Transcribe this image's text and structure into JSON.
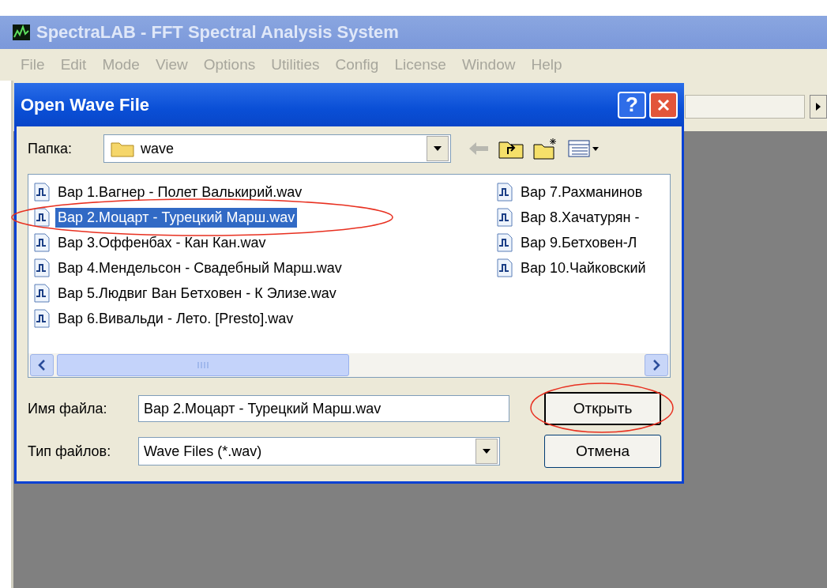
{
  "app": {
    "title": "SpectraLAB - FFT Spectral Analysis System",
    "menu": [
      {
        "label": "File",
        "disabled": true
      },
      {
        "label": "Edit",
        "disabled": true
      },
      {
        "label": "Mode",
        "disabled": true
      },
      {
        "label": "View",
        "disabled": true
      },
      {
        "label": "Options",
        "disabled": true
      },
      {
        "label": "Utilities",
        "disabled": true
      },
      {
        "label": "Config",
        "disabled": true
      },
      {
        "label": "License",
        "disabled": true
      },
      {
        "label": "Window",
        "disabled": true
      },
      {
        "label": "Help",
        "disabled": true
      }
    ]
  },
  "dialog": {
    "title": "Open Wave File",
    "help_button": "?",
    "folder": {
      "label": "Папка:",
      "value": "wave"
    },
    "files": [
      {
        "name": "Вар 1.Вагнер - Полет Валькирий.wav",
        "selected": false,
        "circled": false
      },
      {
        "name": "Вар 2.Моцарт - Турецкий Марш.wav",
        "selected": true,
        "circled": true
      },
      {
        "name": "Вар 3.Оффенбах - Кан Кан.wav",
        "selected": false,
        "circled": false
      },
      {
        "name": "Вар 4.Мендельсон - Свадебный Марш.wav",
        "selected": false,
        "circled": false
      },
      {
        "name": "Вар 5.Людвиг Ван Бетховен - К Элизе.wav",
        "selected": false,
        "circled": false
      },
      {
        "name": "Вар 6.Вивальди - Лето. [Presto].wav",
        "selected": false,
        "circled": false
      },
      {
        "name": "Вар 7.Рахманинов",
        "selected": false,
        "circled": false
      },
      {
        "name": "Вар 8.Хачатурян -",
        "selected": false,
        "circled": false
      },
      {
        "name": "Вар 9.Бетховен-Л",
        "selected": false,
        "circled": false
      },
      {
        "name": "Вар 10.Чайковский",
        "selected": false,
        "circled": false
      }
    ],
    "file_name": {
      "label": "Имя файла:",
      "value": "Вар 2.Моцарт - Турецкий Марш.wav"
    },
    "file_type": {
      "label": "Тип файлов:",
      "value": "Wave Files (*.wav)"
    },
    "buttons": [
      {
        "label": "Открыть",
        "kind": "default",
        "circled": true
      },
      {
        "label": "Отмена",
        "kind": "normal",
        "circled": false
      }
    ]
  }
}
